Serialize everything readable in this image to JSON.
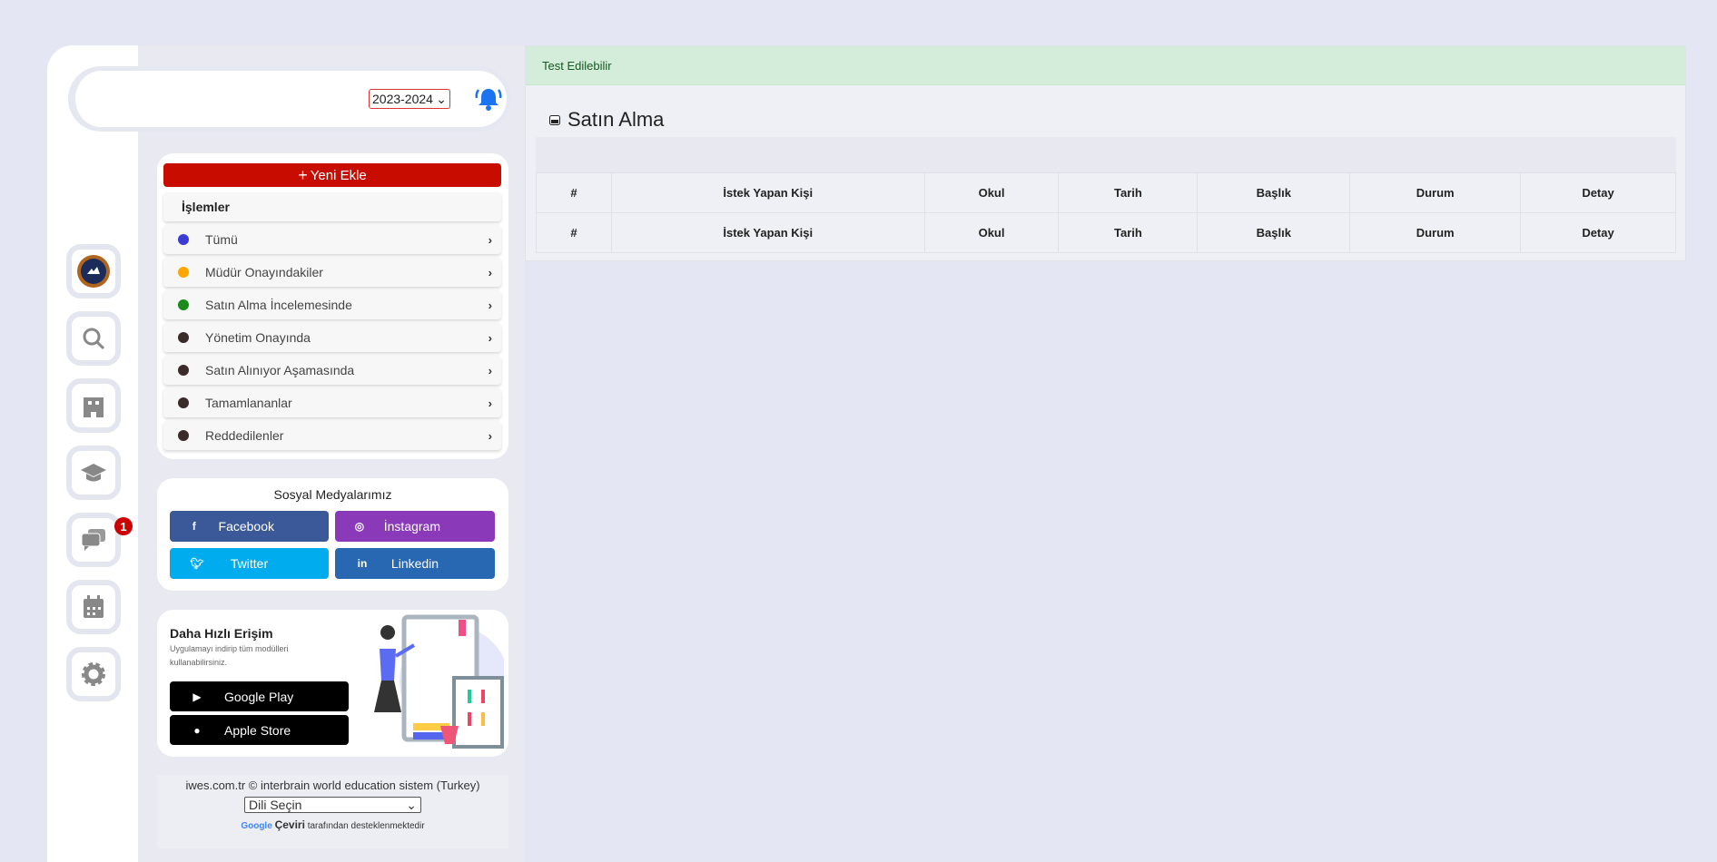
{
  "header": {
    "year": "2023-2024"
  },
  "nav": {
    "badge": "1",
    "items": [
      "logo",
      "search-icon",
      "building-icon",
      "graduation-cap-icon",
      "chat-icon",
      "calendar-icon",
      "gear-icon"
    ]
  },
  "actions": {
    "new_label": "Yeni Ekle",
    "section_title": "İşlemler",
    "items": [
      {
        "label": "Tümü",
        "color": "#3b3bd6"
      },
      {
        "label": "Müdür Onayındakiler",
        "color": "#ffa500"
      },
      {
        "label": "Satın Alma İncelemesinde",
        "color": "#1a8a1a"
      },
      {
        "label": "Yönetim Onayında",
        "color": "#3a2a2a"
      },
      {
        "label": "Satın Alınıyor Aşamasında",
        "color": "#3a2a2a"
      },
      {
        "label": "Tamamlananlar",
        "color": "#3a2a2a"
      },
      {
        "label": "Reddedilenler",
        "color": "#3a2a2a"
      }
    ]
  },
  "social": {
    "title": "Sosyal Medyalarımız",
    "facebook": "Facebook",
    "instagram": "İnstagram",
    "twitter": "Twitter",
    "linkedin": "Linkedin"
  },
  "app": {
    "title": "Daha Hızlı Erişim",
    "desc": "Uygulamayı indirip tüm modülleri kullanabilirsiniz.",
    "google": "Google Play",
    "apple": "Apple Store"
  },
  "footer": {
    "copyright": "iwes.com.tr © interbrain world education sistem (Turkey)",
    "lang": "Dili Seçin",
    "google": "Google",
    "ceviri": "Çeviri",
    "powered": "tarafından desteklenmektedir"
  },
  "main": {
    "alert": "Test Edilebilir",
    "title": "Satın Alma",
    "columns": [
      "#",
      "İstek Yapan Kişi",
      "Okul",
      "Tarih",
      "Başlık",
      "Durum",
      "Detay"
    ]
  }
}
